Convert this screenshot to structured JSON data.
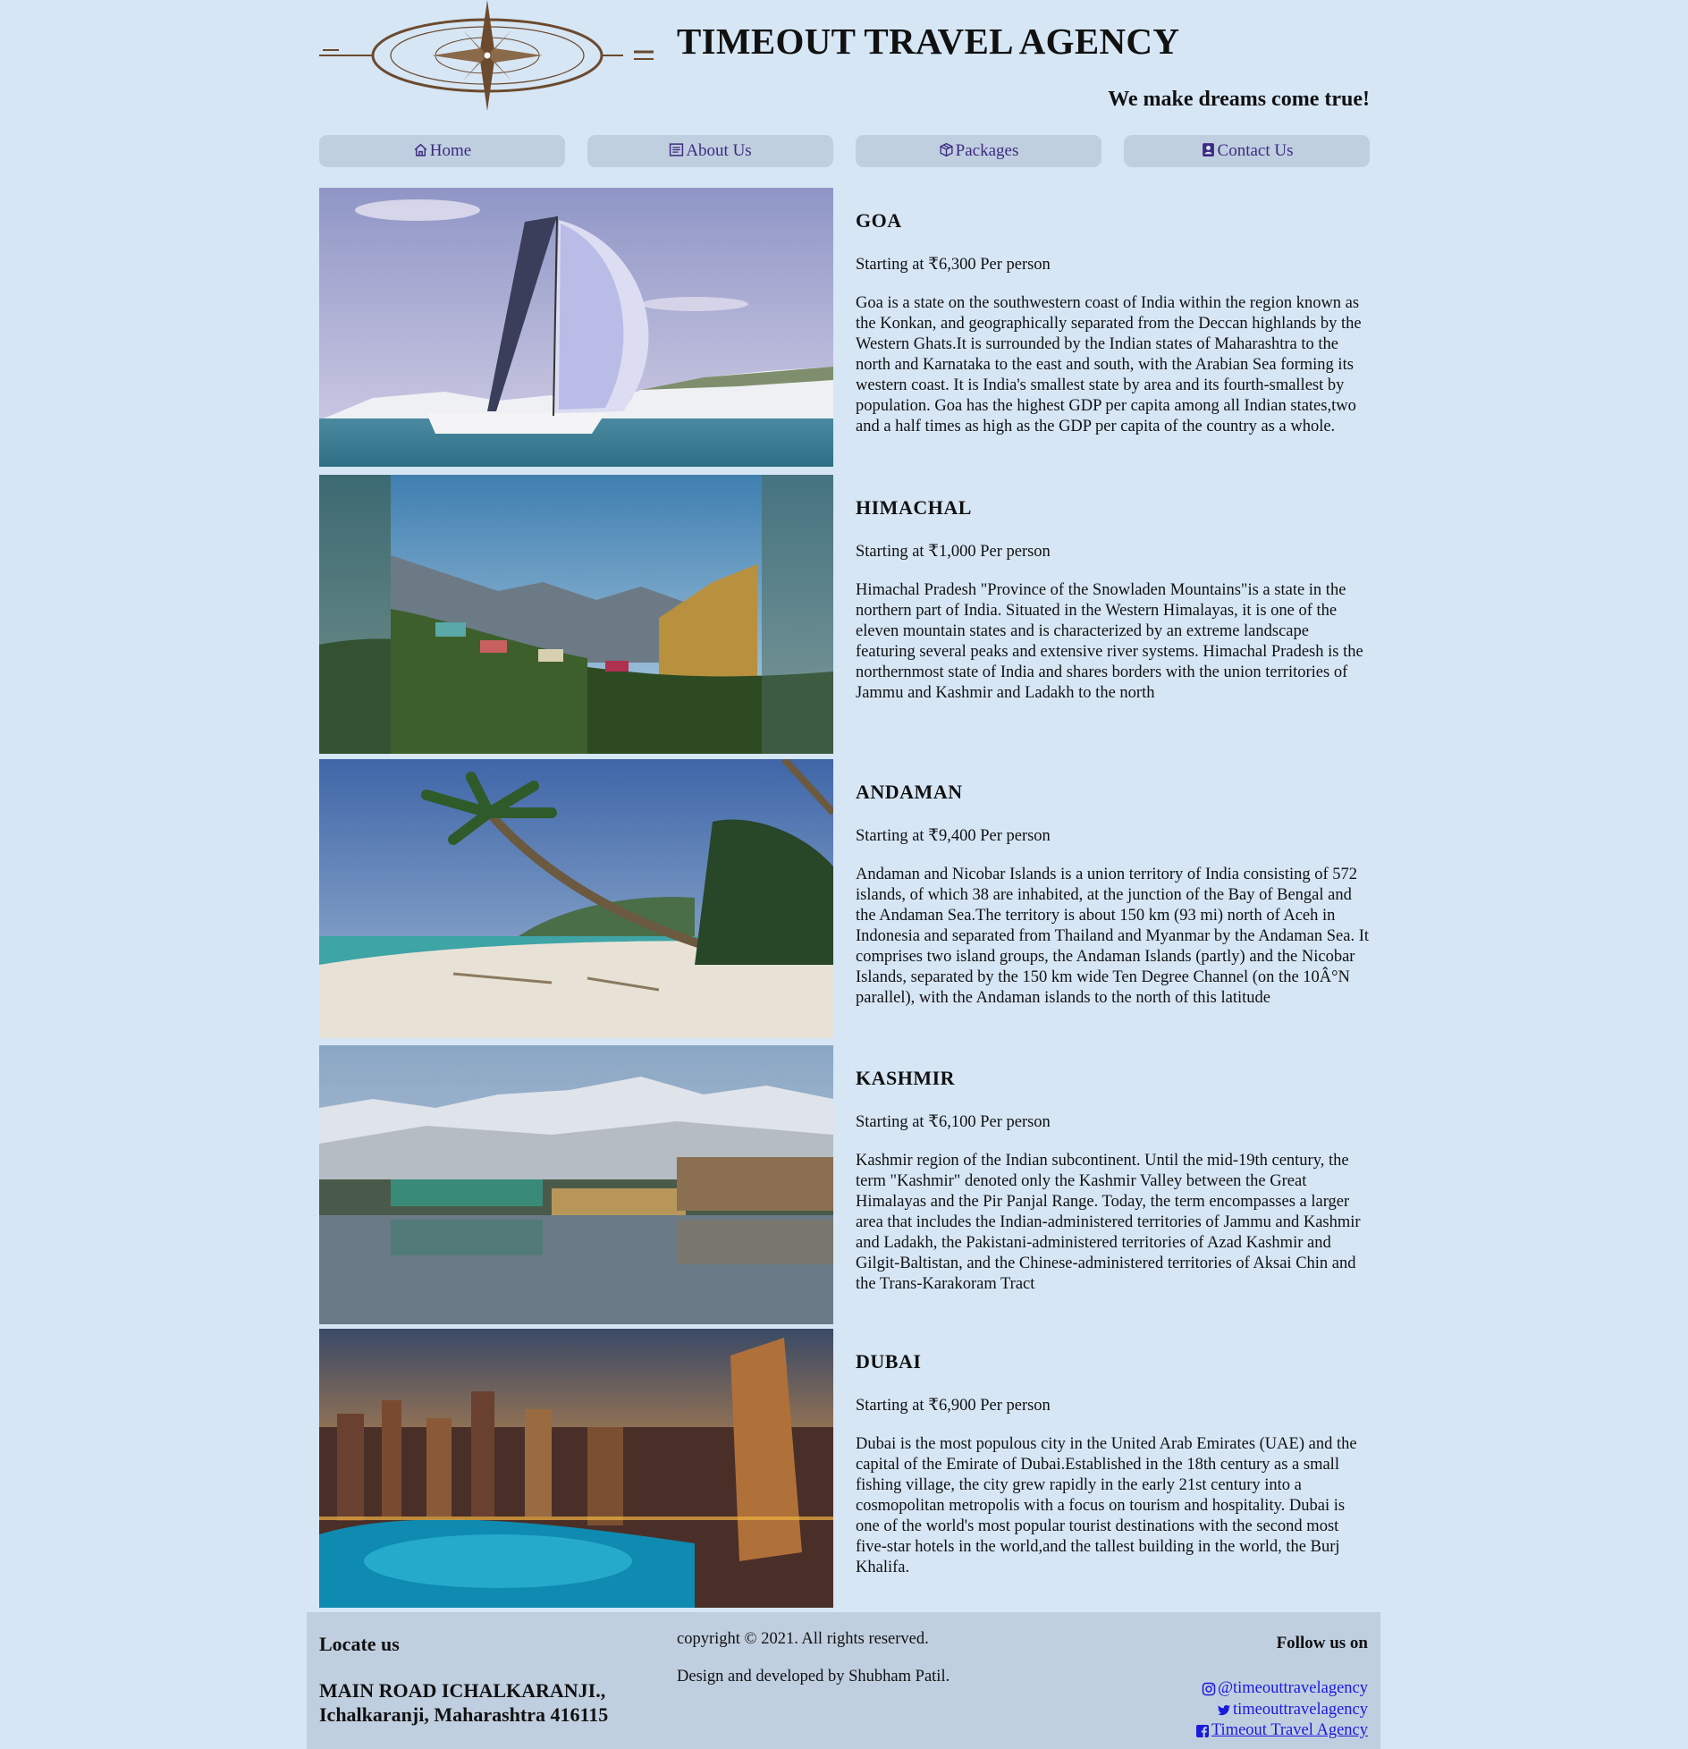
{
  "header": {
    "title": "TIMEOUT TRAVEL AGENCY",
    "tagline": "We make dreams come true!"
  },
  "nav": {
    "home": "Home",
    "about": "About Us",
    "packages": "Packages",
    "contact": "Contact Us"
  },
  "packages": [
    {
      "name": "GOA",
      "price": "Starting at ₹6,300 Per person",
      "description": "Goa is a state on the southwestern coast of India within the region known as the Konkan, and geographically separated from the Deccan highlands by the Western Ghats.It is surrounded by the Indian states of Maharashtra to the north and Karnataka to the east and south, with the Arabian Sea forming its western coast. It is India's smallest state by area and its fourth-smallest by population. Goa has the highest GDP per capita among all Indian states,two and a half times as high as the GDP per capita of the country as a whole."
    },
    {
      "name": "HIMACHAL",
      "price": "Starting at ₹1,000 Per person",
      "description": "Himachal Pradesh \"Province of the Snowladen Mountains\"is a state in the northern part of India. Situated in the Western Himalayas, it is one of the eleven mountain states and is characterized by an extreme landscape featuring several peaks and extensive river systems. Himachal Pradesh is the northernmost state of India and shares borders with the union territories of Jammu and Kashmir and Ladakh to the north"
    },
    {
      "name": "ANDAMAN",
      "price": "Starting at ₹9,400 Per person",
      "description": "Andaman and Nicobar Islands is a union territory of India consisting of 572 islands, of which 38 are inhabited, at the junction of the Bay of Bengal and the Andaman Sea.The territory is about 150 km (93 mi) north of Aceh in Indonesia and separated from Thailand and Myanmar by the Andaman Sea. It comprises two island groups, the Andaman Islands (partly) and the Nicobar Islands, separated by the 150 km wide Ten Degree Channel (on the 10Â°N parallel), with the Andaman islands to the north of this latitude"
    },
    {
      "name": "KASHMIR",
      "price": "Starting at ₹6,100 Per person",
      "description": "Kashmir region of the Indian subcontinent. Until the mid-19th century, the term \"Kashmir\" denoted only the Kashmir Valley between the Great Himalayas and the Pir Panjal Range. Today, the term encompasses a larger area that includes the Indian-administered territories of Jammu and Kashmir and Ladakh, the Pakistani-administered territories of Azad Kashmir and Gilgit-Baltistan, and the Chinese-administered territories of Aksai Chin and the Trans-Karakoram Tract"
    },
    {
      "name": "DUBAI",
      "price": "Starting at ₹6,900 Per person",
      "description": "Dubai is the most populous city in the United Arab Emirates (UAE) and the capital of the Emirate of Dubai.Established in the 18th century as a small fishing village, the city grew rapidly in the early 21st century into a cosmopolitan metropolis with a focus on tourism and hospitality. Dubai is one of the world's most popular tourist destinations with the second most five-star hotels in the world,and the tallest building in the world, the Burj Khalifa."
    }
  ],
  "footer": {
    "locate_title": "Locate us",
    "address_line1": "MAIN ROAD ICHALKARANJI.,",
    "address_line2": "Ichalkaranji, Maharashtra 416115",
    "copyright": "copyright © 2021. All rights reserved.",
    "credit": "Design and developed by Shubham Patil.",
    "follow_title": "Follow us on",
    "instagram": "@timeouttravelagency",
    "twitter": "timeouttravelagency",
    "facebook": "Timeout Travel Agency"
  },
  "icons": {
    "logo": "compass-rose-logo",
    "home": "home-icon",
    "about": "document-icon",
    "packages": "box-icon",
    "contact": "contact-card-icon",
    "instagram": "instagram-icon",
    "twitter": "twitter-icon",
    "facebook": "facebook-icon"
  },
  "colors": {
    "page_background": "#d6e6f5",
    "nav_button": "#bfcfe0",
    "nav_text": "#3e2a80",
    "footer_background": "#c0cfe0",
    "link": "#1a1adb"
  }
}
